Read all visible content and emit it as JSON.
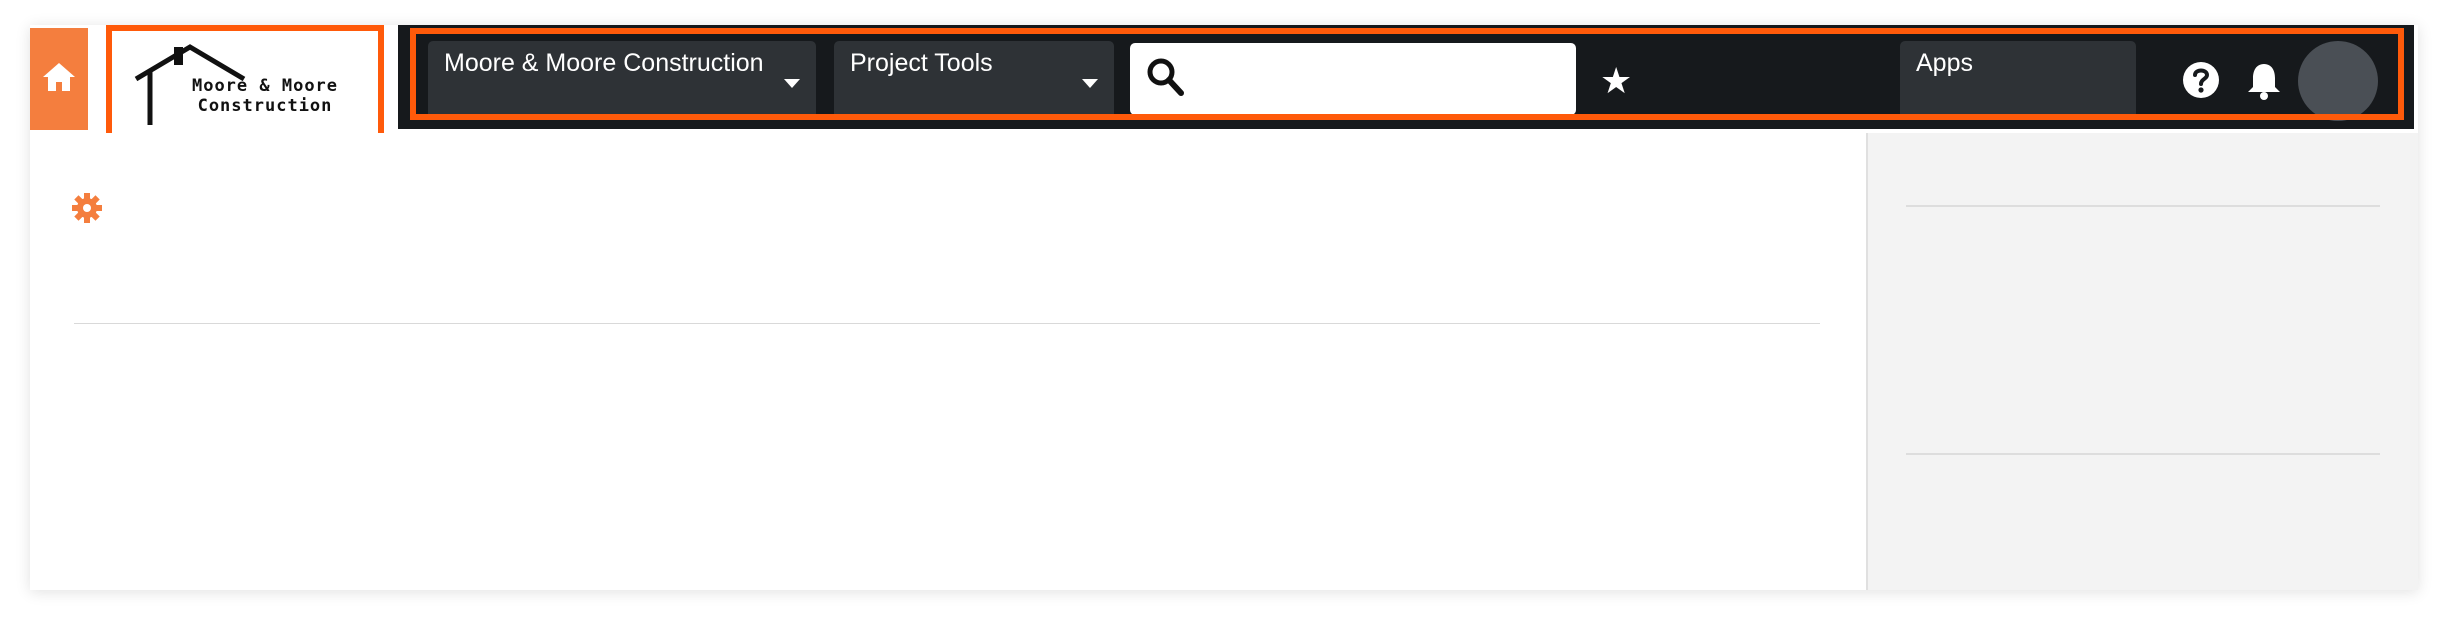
{
  "logo": {
    "line1": "Moore & Moore",
    "line2": "Construction"
  },
  "nav": {
    "company_dropdown": "Moore & Moore Construction",
    "tools_dropdown": "Project Tools",
    "search": {
      "value": "",
      "placeholder": ""
    },
    "apps_label": "Apps"
  },
  "icons": {
    "home": "home-icon",
    "search": "search-icon",
    "favorite": "star-icon",
    "help": "help-icon",
    "notifications": "bell-icon",
    "settings": "gear-icon"
  },
  "colors": {
    "accent": "#ff5a0a",
    "home_button": "#f47e3e",
    "navbar": "#16191c",
    "dropdown": "#2e3236",
    "gear": "#f47e3e",
    "sidebar": "#f3f3f3"
  }
}
